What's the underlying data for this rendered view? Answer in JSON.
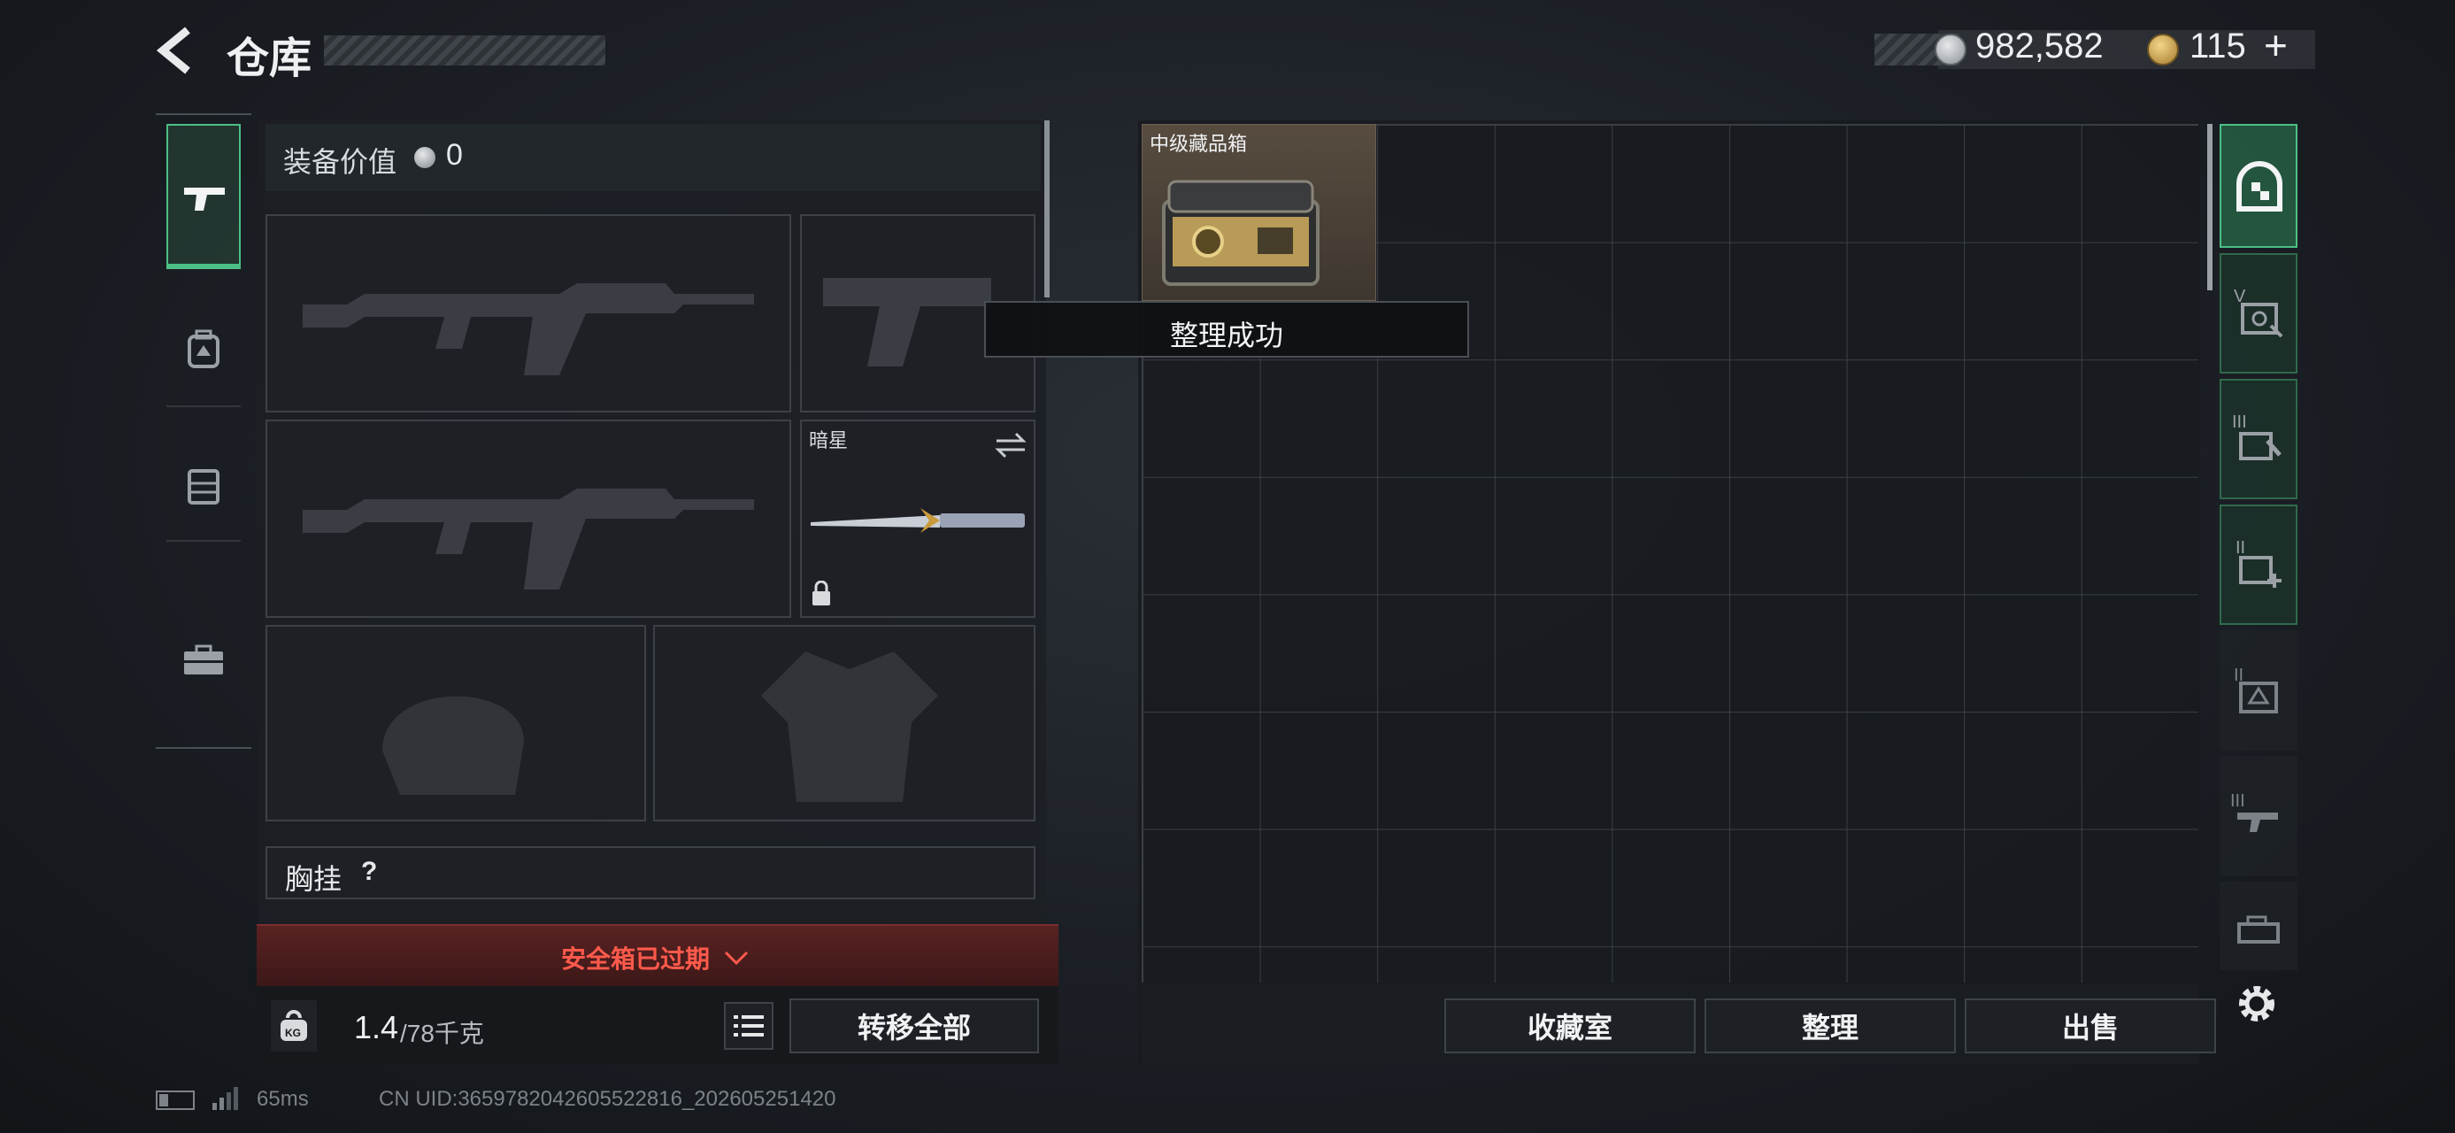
{
  "header": {
    "title": "仓库",
    "silver_currency": "982,582",
    "gold_currency": "115",
    "add_symbol": "+"
  },
  "left_panel": {
    "equip_value_label": "装备价值",
    "equip_value": "0",
    "knife_slot_label": "暗星",
    "chest_rig_label": "胸挂",
    "chest_rig_help": "?",
    "safe_box_status": "安全箱已过期",
    "weight_current": "1.4",
    "weight_max": "/78千克",
    "weight_unit_icon": "KG",
    "transfer_all_label": "转移全部"
  },
  "storage": {
    "first_item_label": "中级藏品箱",
    "toast": "整理成功",
    "buttons": {
      "collection": "收藏室",
      "organize": "整理",
      "sell": "出售"
    }
  },
  "status_bar": {
    "ping": "65ms",
    "uid_text": "CN UID:3659782042605522816_202605251420"
  },
  "side_tab_numerals": [
    "V",
    "III",
    "II",
    "II",
    "III"
  ],
  "colors": {
    "accent_green": "#4bbf85",
    "warning_red": "#e0483e",
    "safe_box_bg": "#4a1e1e"
  }
}
